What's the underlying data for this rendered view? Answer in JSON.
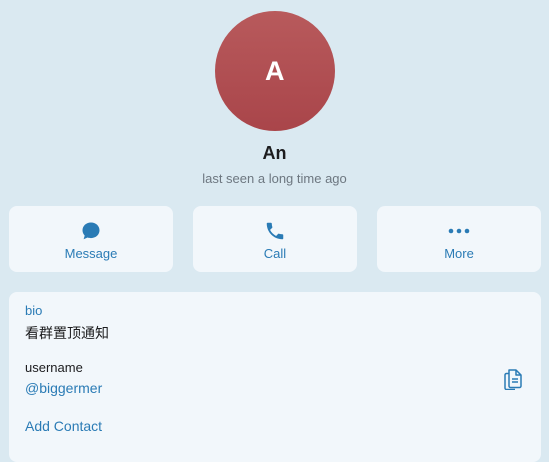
{
  "profile": {
    "avatar_letter": "A",
    "name": "An",
    "status": "last seen a long time ago",
    "avatar_color": "#b04f52"
  },
  "actions": [
    {
      "label": "Message",
      "icon": "chat-bubble-icon"
    },
    {
      "label": "Call",
      "icon": "phone-icon"
    },
    {
      "label": "More",
      "icon": "more-dots-icon"
    }
  ],
  "info": {
    "bio_label": "bio",
    "bio_value": "看群置顶通知",
    "username_label": "username",
    "username_value": "@biggermer",
    "copy_icon": "copy-icon",
    "add_contact_label": "Add Contact"
  },
  "colors": {
    "background": "#dae9f1",
    "card": "#f2f7fb",
    "accent": "#2a7bb5",
    "text": "#1c1c1e",
    "muted": "#6d7780"
  }
}
